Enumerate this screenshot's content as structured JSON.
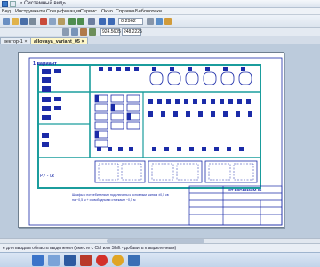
{
  "window": {
    "title": "« Системный вид»"
  },
  "menu": {
    "items": [
      "Вид",
      "Инструменты",
      "Спецификация",
      "Сервис",
      "Окно",
      "Справка",
      "Библиотеки"
    ]
  },
  "toolbar": {
    "zoom_value": "0.2962",
    "coord_x": "924.5605",
    "coord_y": "248.2225"
  },
  "tabs": [
    {
      "label": "вектор-1 ×"
    },
    {
      "label": "allovaya_variant_05 ×"
    }
  ],
  "drawing": {
    "sheet_corner_label": "1 вариант",
    "note_line1": "Шкафы с потребителями подключены к основным шинам ±0,5 кв",
    "note_line2": "на ~0,5 м + и свободными отсеками ~0,5 м",
    "stamp_code": "СТ ВКР.1315ЭМ-05",
    "panel_label": "РУ - 0к"
  },
  "status": {
    "message": "е для ввода в область выделения (вместе с Ctrl или Shift - добавить к выделенным)"
  },
  "colors": {
    "wire": "#1b9d9d",
    "equipment": "#1b2ba8",
    "tab_active": "#fff7c8"
  }
}
